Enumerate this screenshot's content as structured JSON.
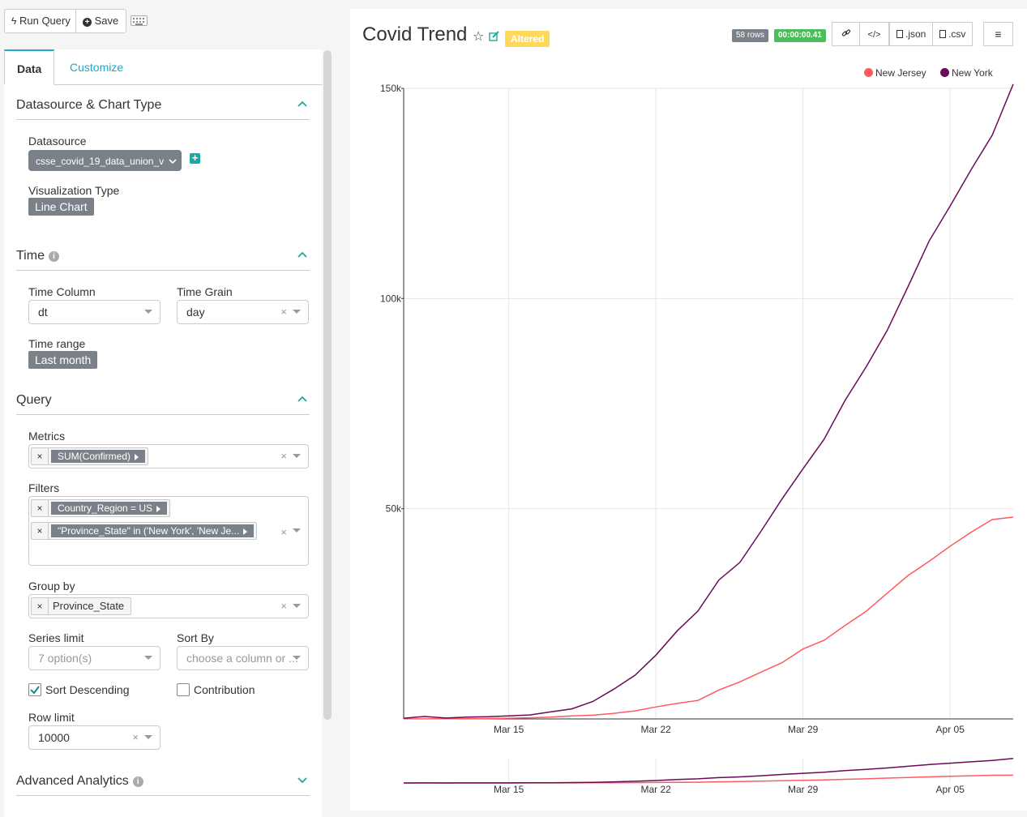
{
  "toolbar": {
    "run_query_label": "Run Query",
    "save_label": "Save"
  },
  "tabs": [
    {
      "label": "Data",
      "active": true
    },
    {
      "label": "Customize",
      "active": false
    }
  ],
  "sections": {
    "datasource": {
      "title": "Datasource & Chart Type",
      "datasource_label": "Datasource",
      "datasource_value": "csse_covid_19_data_union_v",
      "viz_label": "Visualization Type",
      "viz_value": "Line Chart"
    },
    "time": {
      "title": "Time",
      "time_column_label": "Time Column",
      "time_column_value": "dt",
      "time_grain_label": "Time Grain",
      "time_grain_value": "day",
      "time_range_label": "Time range",
      "time_range_value": "Last month"
    },
    "query": {
      "title": "Query",
      "metrics_label": "Metrics",
      "metrics": [
        "SUM(Confirmed)"
      ],
      "filters_label": "Filters",
      "filters": [
        "Country_Region = US",
        "\"Province_State\" in ('New York', 'New Je..."
      ],
      "group_by_label": "Group by",
      "group_by": [
        "Province_State"
      ],
      "series_limit_label": "Series limit",
      "series_limit_placeholder": "7 option(s)",
      "sort_by_label": "Sort By",
      "sort_by_placeholder": "choose a column or ...",
      "sort_descending_label": "Sort Descending",
      "sort_descending_checked": true,
      "contribution_label": "Contribution",
      "contribution_checked": false,
      "row_limit_label": "Row limit",
      "row_limit_value": "10000"
    },
    "advanced": {
      "title": "Advanced Analytics"
    }
  },
  "chart_header": {
    "title": "Covid Trend",
    "altered_label": "Altered",
    "rows_badge": "58 rows",
    "time_badge": "00:00:00.41",
    "json_label": ".json",
    "csv_label": ".csv"
  },
  "colors": {
    "new_jersey": "#ff5a5f",
    "new_york": "#6b0a5a",
    "accent": "#20a7c9"
  },
  "chart_data": {
    "type": "line",
    "x": [
      "2020-03-10",
      "2020-03-11",
      "2020-03-12",
      "2020-03-13",
      "2020-03-14",
      "2020-03-15",
      "2020-03-16",
      "2020-03-17",
      "2020-03-18",
      "2020-03-19",
      "2020-03-20",
      "2020-03-21",
      "2020-03-22",
      "2020-03-23",
      "2020-03-24",
      "2020-03-25",
      "2020-03-26",
      "2020-03-27",
      "2020-03-28",
      "2020-03-29",
      "2020-03-30",
      "2020-03-31",
      "2020-04-01",
      "2020-04-02",
      "2020-04-03",
      "2020-04-04",
      "2020-04-05",
      "2020-04-06",
      "2020-04-07",
      "2020-04-08"
    ],
    "series": [
      {
        "name": "New Jersey",
        "values": [
          15,
          23,
          29,
          69,
          98,
          177,
          267,
          427,
          742,
          890,
          1327,
          1914,
          2844,
          3675,
          4402,
          6876,
          8825,
          11124,
          13386,
          16636,
          18696,
          22255,
          25590,
          29895,
          34124,
          37505,
          41090,
          44416,
          47437,
          48000
        ]
      },
      {
        "name": "New York",
        "values": [
          173,
          573,
          220,
          421,
          525,
          729,
          950,
          1700,
          2382,
          4152,
          7102,
          10356,
          15168,
          20875,
          25665,
          33066,
          37258,
          44635,
          52318,
          59513,
          66497,
          75795,
          83712,
          92381,
          102863,
          113704,
          122031,
          130689,
          138863,
          151000
        ]
      }
    ],
    "x_ticks": [
      "Mar 15",
      "Mar 22",
      "Mar 29",
      "Apr 05"
    ],
    "y_ticks": [
      "50k",
      "100k",
      "150k"
    ],
    "ylim": [
      0,
      150000
    ],
    "grid": true,
    "legend_position": "top-right",
    "brush_preview": true
  }
}
